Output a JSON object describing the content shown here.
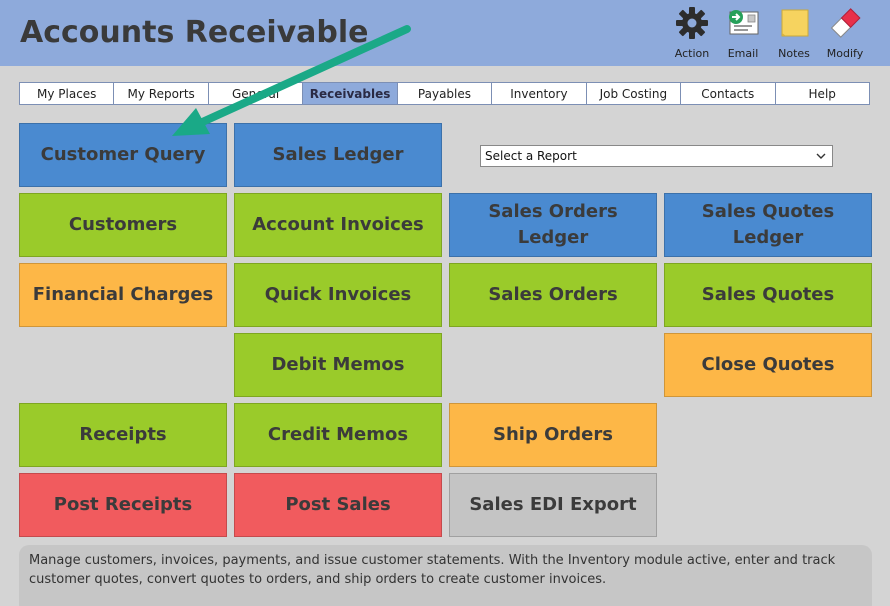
{
  "app": {
    "title": "Accounts Receivable"
  },
  "toolbar": {
    "items": [
      {
        "label": "Action",
        "icon": "gear-icon"
      },
      {
        "label": "Email",
        "icon": "email-icon"
      },
      {
        "label": "Notes",
        "icon": "sticky-note-icon"
      },
      {
        "label": "Modify",
        "icon": "eraser-icon"
      }
    ]
  },
  "tabs": [
    {
      "label": "My Places",
      "active": false
    },
    {
      "label": "My Reports",
      "active": false
    },
    {
      "label": "General",
      "active": false
    },
    {
      "label": "Receivables",
      "active": true
    },
    {
      "label": "Payables",
      "active": false
    },
    {
      "label": "Inventory",
      "active": false
    },
    {
      "label": "Job Costing",
      "active": false
    },
    {
      "label": "Contacts",
      "active": false
    },
    {
      "label": "Help",
      "active": false
    }
  ],
  "report_select": {
    "value": "Select a Report"
  },
  "tiles": {
    "customer_query": "Customer Query",
    "sales_ledger": "Sales Ledger",
    "customers": "Customers",
    "account_invoices": "Account Invoices",
    "sales_orders_ledger": "Sales Orders\nLedger",
    "sales_quotes_ledger": "Sales Quotes\nLedger",
    "financial_charges": "Financial Charges",
    "quick_invoices": "Quick Invoices",
    "sales_orders": "Sales Orders",
    "sales_quotes": "Sales Quotes",
    "debit_memos": "Debit Memos",
    "close_quotes": "Close Quotes",
    "receipts": "Receipts",
    "credit_memos": "Credit Memos",
    "ship_orders": "Ship Orders",
    "post_receipts": "Post Receipts",
    "post_sales": "Post Sales",
    "sales_edi_export": "Sales EDI Export"
  },
  "description": "Manage customers, invoices, payments, and issue customer statements. With the Inventory module active, enter and track customer quotes, convert quotes to orders, and ship orders to create customer invoices.",
  "colors": {
    "header": "#8eaadb",
    "blue": "#4a8ad0",
    "green": "#9acb2a",
    "orange": "#fdb747",
    "red": "#f15b5e",
    "gray": "#c4c4c4",
    "arrow": "#1aa987"
  }
}
